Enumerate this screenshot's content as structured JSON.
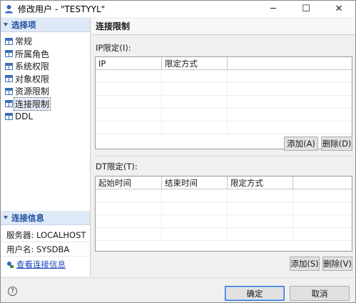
{
  "window": {
    "title": "修改用户 - \"TESTYYL\"",
    "controls": {
      "minimize": "─",
      "maximize": "☐",
      "close": "✕"
    }
  },
  "sidebar": {
    "section_title": "选择项",
    "items": [
      {
        "label": "常规"
      },
      {
        "label": "所属角色"
      },
      {
        "label": "系统权限"
      },
      {
        "label": "对象权限"
      },
      {
        "label": "资源限制"
      },
      {
        "label": "连接限制"
      },
      {
        "label": "DDL"
      }
    ],
    "selected_index": 5
  },
  "connection": {
    "section_title": "连接信息",
    "server": "服务器: LOCALHOST",
    "username": "用户名: SYSDBA",
    "view_link": "查看连接信息"
  },
  "main": {
    "title": "连接限制",
    "ip": {
      "label": "IP限定(I):",
      "columns": [
        "IP",
        "限定方式"
      ],
      "rows": [],
      "add_label": "添加(A)",
      "delete_label": "删除(D)"
    },
    "dt": {
      "label": "DT限定(T):",
      "columns": [
        "起始时间",
        "结束时间",
        "限定方式"
      ],
      "rows": [],
      "add_label": "添加(S)",
      "delete_label": "删除(V)"
    }
  },
  "footer": {
    "help_icon": "?",
    "ok_label": "确定",
    "cancel_label": "取消"
  },
  "colors": {
    "accent": "#1d4fa0",
    "section_bg": "#dfe8f6",
    "link": "#1c46b8",
    "primary_border": "#2b6fd6"
  }
}
